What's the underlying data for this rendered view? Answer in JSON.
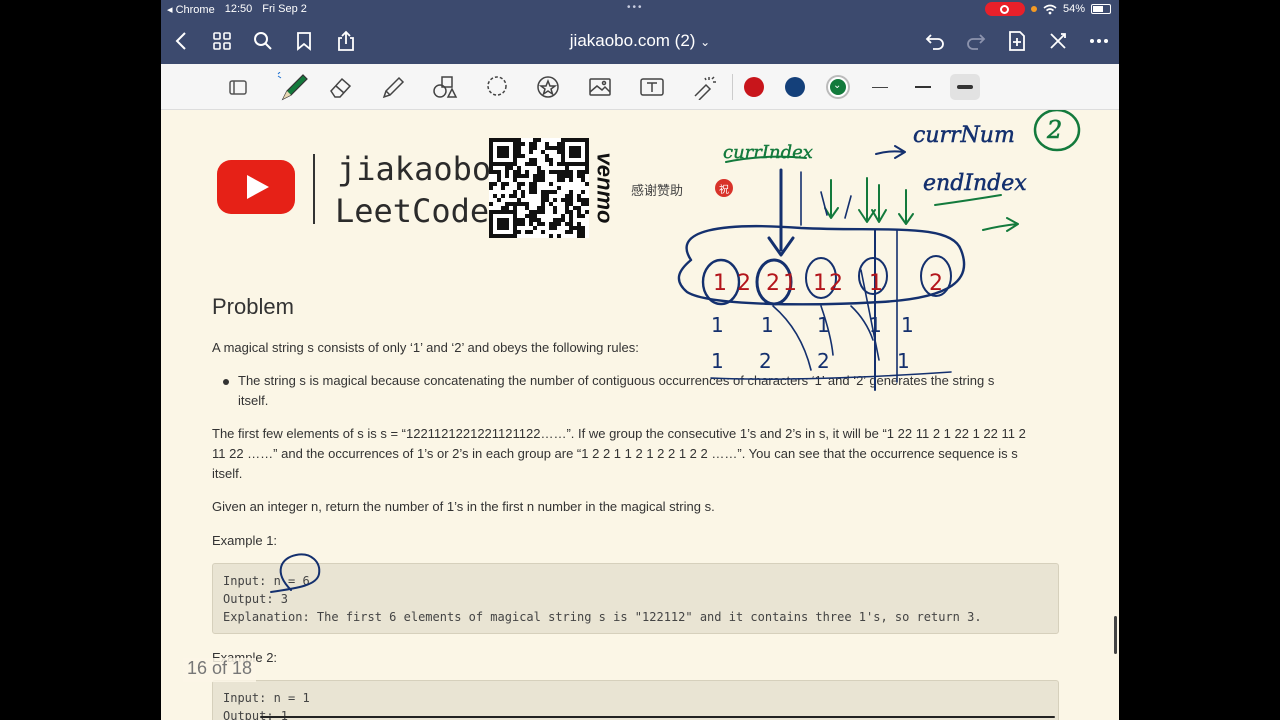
{
  "status": {
    "back_app": "Chrome",
    "time": "12:50",
    "date": "Fri Sep 2",
    "battery": "54%"
  },
  "nav": {
    "title": "jiakaobo.com (2)",
    "title_suffix": "⌄"
  },
  "toolbar": {
    "tools": [
      "read-mode",
      "pen",
      "eraser",
      "highlighter",
      "shapes",
      "lasso",
      "sticker",
      "image",
      "text",
      "laser"
    ],
    "colors": [
      "#c8151b",
      "#14407a",
      "#137a3c"
    ],
    "selected_color": "#137a3c"
  },
  "banner": {
    "brand_line1": "jiakaobo",
    "brand_line2": "LeetCode",
    "venmo": "venmo",
    "thanks": "感谢赞助",
    "blessing": "祝"
  },
  "problem": {
    "heading": "Problem",
    "intro": "A magical string s consists of only ‘1’ and ‘2’ and obeys the following rules:",
    "rule_line1": "The string s is magical because concatenating the number of contiguous occurrences of characters ‘1’ and ‘2’ generates the string s",
    "rule_line2": "itself.",
    "desc_line1": "The first few elements of s is s = “1221121221221121122……”. If we group the consecutive 1’s and 2’s in s, it will be “1 22 11 2 1 22 1 22 11 2",
    "desc_line2": "11 22 ……” and the occurrences of 1’s or 2’s in each group are “1 2 2 1 1 2 1 2 2 1 2 2 ……”. You can see that the occurrence sequence is s",
    "desc_line3": "itself.",
    "task": "Given an integer n, return the number of 1’s in the first n number in the magical string s.",
    "example1_title": "Example 1:",
    "example1_input": "Input: n = 6",
    "example1_output": "Output: 3",
    "example1_explanation": "Explanation: The first 6 elements of magical string s is \"122112\" and it contains three 1's, so return 3.",
    "example2_title": "Example 2:",
    "example2_input": "Input: n = 1",
    "example2_output": "Output: 1"
  },
  "page_indicator": "16 of 18",
  "annotations": {
    "curr_index": "currIndex",
    "curr_num": "currNum",
    "curr_num_value": "2",
    "end_index": "endIndex",
    "array_digits": [
      "1",
      "2",
      "2",
      "1",
      "1",
      "2",
      "1",
      "2"
    ],
    "count_digits": [
      "1",
      "1",
      "1",
      "1",
      "1"
    ],
    "bottom_digits": [
      "1",
      "2",
      "2",
      "1"
    ]
  }
}
